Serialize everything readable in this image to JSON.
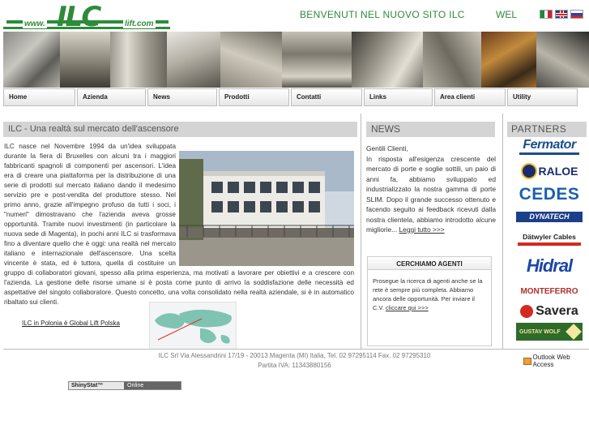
{
  "header": {
    "logo_www": "www.",
    "logo_ilc": "ILC",
    "logo_lift": "lift.com",
    "welcome": "BENVENUTI NEL NUOVO SITO ILC",
    "wel": "WEL",
    "flags": [
      "italian-flag-icon",
      "uk-flag-icon",
      "russian-flag-icon"
    ]
  },
  "nav": {
    "items": [
      "Home",
      "Azienda",
      "News",
      "Prodotti",
      "Contatti",
      "Links",
      "Area clienti",
      "Utility"
    ]
  },
  "main": {
    "title": "ILC - Una realtà sul mercato dell'ascensore",
    "intro": "ILC nasce nel Novembre 1994 da un'idea sviluppata durante la fiera di Bruxelles con alcuni tra i maggiori fabbricanti spagnoli di componenti per ascensori. L'idea era di creare una piattaforma per la distribuzione di una serie di prodotti sul mercato italiano dando il medesimo servizio pre e post-vendita del produttore stesso. Nel primo anno, grazie all'impegno profuso da tutti i soci, i \"numeri\" dimostravano che l'azienda aveva grosse opportunità. Tramite nuovi investimenti (in particolare la nuova sede di Magenta), in pochi anni ILC si trasformava fino a diventare quello che è oggi: una realtà nel mercato italiano e internazionale dell'ascensore. Una scelta vincente è stata, ed è tuttora, quella di costituire un gruppo di collaboratori giovani, spesso alla prima esperienza, ma motivati a lavorare per obiettivi e a crescere con l'azienda. La gestione delle risorse umane si è posta come punto di arrivo la soddisfazione delle necessità ed aspettative del singolo collaboratore. Questo concetto, una volta consolidato nella realtà aziendale, si è in automatico ribaltato sui clienti.",
    "polska_link": "ILC in Polonia è Global Lift Polska"
  },
  "news": {
    "title": "NEWS",
    "greeting": "Gentili Clienti,",
    "body": "In risposta all'esigenza crescente del mercato di porte e soglie sottili, un paio di anni fa, abbiamo sviluppato ed industrializzato la nostra gamma di porte SLIM. Dopo il grande successo ottenuto e facendo seguito ai feedback ricevuti dalla nostra clientela, abbiamo introdotto alcune migliorie... ",
    "more_link": "Leggi tutto >>>"
  },
  "agents": {
    "title": "CERCHIAMO AGENTI",
    "body": "Prosegue la ricerca di agenti anche se la rete è sempre più completa. Abbiamo ancora delle opportunità. Per inviare il C.V. ",
    "link": "cliccare qui  >>>"
  },
  "partners": {
    "title": "PARTNERS",
    "logos": [
      "Fermator",
      "RALOE",
      "CEDES",
      "DYNATECH",
      "Dätwyler Cables",
      "Hidral",
      "MONTEFERRO",
      "Savera",
      "GUSTAV WOLF"
    ]
  },
  "footer": {
    "address": "ILC Srl Via Alessandrini 17/19 - 20013 Magenta (MI) Italia, Tel. 02 97295114   Fax. 02 97295310",
    "vat": "Partita IVA: 11343880156",
    "owa": "Outlook Web Access",
    "shiny_label": "ShinyStat™",
    "shiny_status": "Online"
  },
  "colors": {
    "brand_green": "#2e8b3a",
    "box_grey": "#d4d4d4"
  }
}
